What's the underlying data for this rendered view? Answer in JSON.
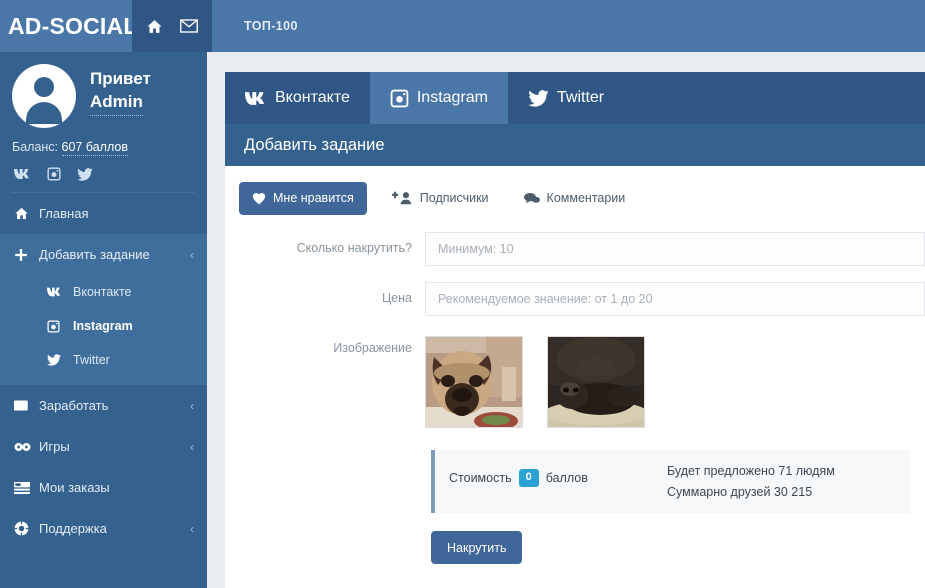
{
  "header": {
    "brand": "AD-SOCIAL",
    "icons": [
      {
        "name": "home-icon",
        "label": "home"
      },
      {
        "name": "envelope-icon",
        "label": "messages"
      }
    ],
    "top_link": "ТОП-100",
    "bg_color": "#4a76a8",
    "icon_block_color": "#2f5685"
  },
  "sidebar": {
    "bg_color": "#35618e",
    "greeting_line1": "Привет",
    "greeting_line2": "Admin",
    "balance_label": "Баланс:",
    "balance_value": "607 баллов",
    "social_icons": [
      "vk-icon",
      "instagram-icon",
      "twitter-icon"
    ],
    "items": [
      {
        "label": "Главная",
        "icon": "home-icon",
        "caret": "",
        "open": false
      },
      {
        "label": "Добавить задание",
        "icon": "plus-icon",
        "caret": "‹",
        "open": true
      },
      {
        "label": "Заработать",
        "icon": "wallet-icon",
        "caret": "‹",
        "open": false
      },
      {
        "label": "Игры",
        "icon": "games-icon",
        "caret": "‹",
        "open": false
      },
      {
        "label": "Мои заказы",
        "icon": "orders-icon",
        "caret": "",
        "open": false
      },
      {
        "label": "Поддержка",
        "icon": "lifebuoy-icon",
        "caret": "‹",
        "open": false
      }
    ],
    "submenu": [
      {
        "label": "Вконтакте",
        "icon": "vk-icon",
        "active": false
      },
      {
        "label": "Instagram",
        "icon": "instagram-icon",
        "active": true
      },
      {
        "label": "Twitter",
        "icon": "twitter-icon",
        "active": false
      }
    ]
  },
  "main": {
    "tabs": [
      {
        "label": "Вконтакте",
        "icon": "vk-icon",
        "active": false
      },
      {
        "label": "Instagram",
        "icon": "instagram-icon",
        "active": true
      },
      {
        "label": "Twitter",
        "icon": "twitter-icon",
        "active": false
      }
    ],
    "panel_title": "Добавить задание",
    "subtabs": [
      {
        "label": "Мне нравится",
        "icon": "heart-icon",
        "active": true
      },
      {
        "label": "Подписчики",
        "icon": "add-user-icon",
        "active": false
      },
      {
        "label": "Комментарии",
        "icon": "comments-icon",
        "active": false
      }
    ],
    "fields": [
      {
        "label": "Сколько накрутить?",
        "placeholder": "Минимум: 10",
        "value": ""
      },
      {
        "label": "Цена",
        "placeholder": "Рекомендуемое значение: от 1 до 20",
        "value": ""
      }
    ],
    "image_label": "Изображение",
    "thumbnails": [
      {
        "name": "thumbnail-pug-photo"
      },
      {
        "name": "thumbnail-dog-photo"
      }
    ],
    "cost": {
      "label": "Стоимость",
      "value": "0",
      "unit": "баллов",
      "badge_color": "#2aa3d4",
      "line1": "Будет предложено 71 людям",
      "line2": "Суммарно друзей 30 215"
    },
    "submit_label": "Накрутить"
  }
}
